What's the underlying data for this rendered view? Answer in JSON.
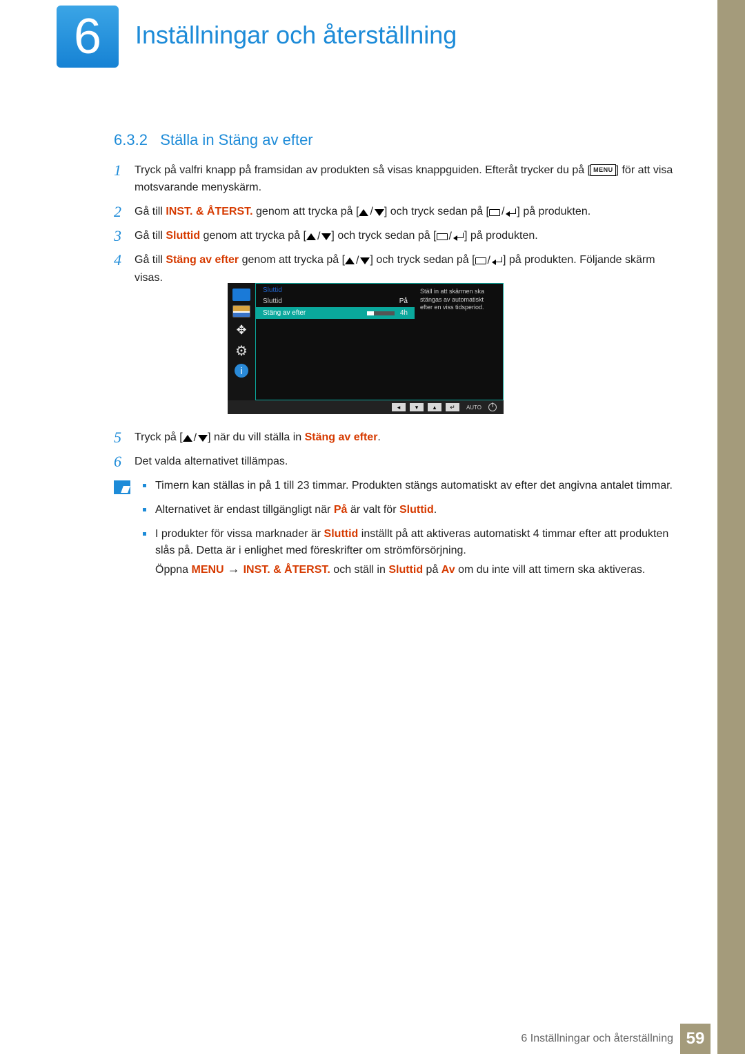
{
  "chapter": {
    "number": "6",
    "title": "Inställningar och återställning"
  },
  "section": {
    "number": "6.3.2",
    "title": "Ställa in Stäng av efter"
  },
  "steps": [
    {
      "n": "1",
      "pre": "Tryck på valfri knapp på framsidan av produkten så visas knappguiden. Efteråt trycker du på [",
      "menu": "MENU",
      "post": "] för att visa motsvarande menyskärm."
    },
    {
      "n": "2",
      "t1": "Gå till ",
      "hl": "INST. & ÅTERST.",
      "t2": " genom att trycka på [",
      "t3": "] och tryck sedan på [",
      "t4": "] på produkten."
    },
    {
      "n": "3",
      "t1": "Gå till ",
      "hl": "Sluttid",
      "t2": " genom att trycka på [",
      "t3": "] och tryck sedan på [",
      "t4": "] på produkten."
    },
    {
      "n": "4",
      "t1": "Gå till ",
      "hl": "Stäng av efter",
      "t2": " genom att trycka på [",
      "t3": "] och tryck sedan på [",
      "t4": "] på produkten. Följande skärm visas."
    }
  ],
  "osd": {
    "title": "Sluttid",
    "row1": {
      "label": "Sluttid",
      "value": "På"
    },
    "row2": {
      "label": "Stäng av efter",
      "value": "4h"
    },
    "desc": "Ställ in att skärmen ska stängas av automatiskt efter en viss tidsperiod.",
    "auto": "AUTO"
  },
  "steps2": [
    {
      "n": "5",
      "t1": "Tryck på [",
      "t2": "] när du vill ställa in ",
      "hl": "Stäng av efter",
      "post": "."
    },
    {
      "n": "6",
      "t": "Det valda alternativet tillämpas."
    }
  ],
  "notes": {
    "li1": "Timern kan ställas in på 1 till 23 timmar. Produkten stängs automatiskt av efter det angivna antalet timmar.",
    "li2_a": "Alternativet är endast tillgängligt när ",
    "li2_hl1": "På",
    "li2_b": " är valt för ",
    "li2_hl2": "Sluttid",
    "li2_c": ".",
    "li3_a": "I produkter för vissa marknader är ",
    "li3_hl1": "Sluttid",
    "li3_b": " inställt på att aktiveras automatiskt 4 timmar efter att produkten slås på. Detta är i enlighet med föreskrifter om strömförsörjning.",
    "li3_c": "Öppna ",
    "li3_menu": "MENU",
    "li3_arrow": " → ",
    "li3_hl2": "INST. & ÅTERST.",
    "li3_d": " och ställ in ",
    "li3_hl3": "Sluttid",
    "li3_e": " på ",
    "li3_hl4": "Av",
    "li3_f": " om du inte vill att timern ska aktiveras."
  },
  "footer": {
    "text": "6 Inställningar och återställning",
    "page": "59"
  }
}
